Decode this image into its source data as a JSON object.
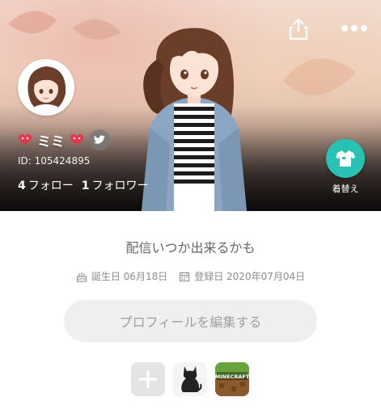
{
  "header": {
    "share_icon": "share-icon",
    "more_icon": "more-dots-icon"
  },
  "profile": {
    "display_name": "💖ミミ💖",
    "name_text": "ミミ",
    "user_id": "ID: 105424895",
    "following_count": "4",
    "following_label": "フォロー",
    "followers_count": "1",
    "followers_label": "フォロワー",
    "social_icon": "twitter-icon"
  },
  "dressup": {
    "label": "着替え",
    "icon": "tshirt-icon",
    "color": "#27c2b3"
  },
  "bio": {
    "text": "配信いつか出来るかも"
  },
  "meta": {
    "birthday_label": "誕生日 06月18日",
    "registered_label": "登録日 2020年07月04日",
    "birthday_icon": "cake-icon",
    "calendar_icon": "calendar-icon"
  },
  "edit_profile": {
    "label": "プロフィールを編集する"
  },
  "apps": {
    "items": [
      {
        "name": "add",
        "icon": "plus-icon"
      },
      {
        "name": "cat",
        "icon": "cat-icon"
      },
      {
        "name": "minecraft",
        "icon": "minecraft-icon",
        "label": "MINECRAFT"
      }
    ]
  },
  "colors": {
    "accent": "#27c2b3",
    "heart": "#e8344c"
  }
}
